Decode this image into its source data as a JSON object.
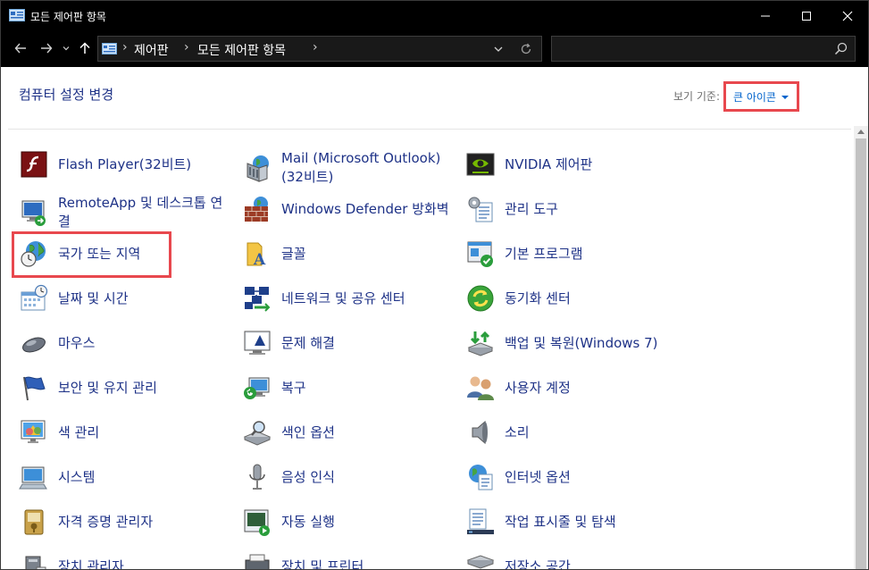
{
  "window": {
    "title": "모든 제어판 항목",
    "minimize_glyph": "—",
    "maximize_glyph": "☐",
    "close_glyph": "✕"
  },
  "address": {
    "crumbs": [
      "제어판",
      "모든 제어판 항목"
    ],
    "separator": "›",
    "search_placeholder": ""
  },
  "content": {
    "heading": "컴퓨터 설정 변경",
    "view_by_label": "보기 기준:",
    "view_mode": "큰 아이콘"
  },
  "items": [
    {
      "label": "Flash Player(32비트)",
      "icon": "flash-icon"
    },
    {
      "label": "Mail (Microsoft Outlook)(32비트)",
      "icon": "mail-icon"
    },
    {
      "label": "NVIDIA 제어판",
      "icon": "nvidia-icon"
    },
    {
      "label": "RemoteApp 및 데스크톱 연결",
      "icon": "remoteapp-icon"
    },
    {
      "label": "Windows Defender 방화벽",
      "icon": "firewall-icon"
    },
    {
      "label": "관리 도구",
      "icon": "admin-tools-icon"
    },
    {
      "label": "국가 또는 지역",
      "icon": "region-icon"
    },
    {
      "label": "글꼴",
      "icon": "fonts-icon"
    },
    {
      "label": "기본 프로그램",
      "icon": "default-programs-icon"
    },
    {
      "label": "날짜 및 시간",
      "icon": "date-time-icon"
    },
    {
      "label": "네트워크 및 공유 센터",
      "icon": "network-icon"
    },
    {
      "label": "동기화 센터",
      "icon": "sync-icon"
    },
    {
      "label": "마우스",
      "icon": "mouse-icon"
    },
    {
      "label": "문제 해결",
      "icon": "troubleshoot-icon"
    },
    {
      "label": "백업 및 복원(Windows 7)",
      "icon": "backup-icon"
    },
    {
      "label": "보안 및 유지 관리",
      "icon": "security-flag-icon"
    },
    {
      "label": "복구",
      "icon": "recovery-icon"
    },
    {
      "label": "사용자 계정",
      "icon": "user-accounts-icon"
    },
    {
      "label": "색 관리",
      "icon": "color-management-icon"
    },
    {
      "label": "색인 옵션",
      "icon": "indexing-icon"
    },
    {
      "label": "소리",
      "icon": "sound-icon"
    },
    {
      "label": "시스템",
      "icon": "system-icon"
    },
    {
      "label": "음성 인식",
      "icon": "microphone-icon"
    },
    {
      "label": "인터넷 옵션",
      "icon": "internet-options-icon"
    },
    {
      "label": "자격 증명 관리자",
      "icon": "credential-icon"
    },
    {
      "label": "자동 실행",
      "icon": "autoplay-icon"
    },
    {
      "label": "작업 표시줄 및 탐색",
      "icon": "taskbar-icon"
    },
    {
      "label": "장치 관리자",
      "icon": "device-manager-icon"
    },
    {
      "label": "장치 및 프린터",
      "icon": "printer-icon"
    },
    {
      "label": "저장소 공간",
      "icon": "storage-icon"
    }
  ]
}
